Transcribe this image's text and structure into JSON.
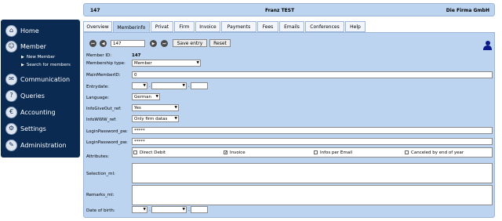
{
  "topbar": {
    "member_id": "147",
    "member_name": "Franz TEST",
    "company": "Die Firma GmbH"
  },
  "sidebar": {
    "items": [
      {
        "label": "Home",
        "icon": "home-icon"
      },
      {
        "label": "Member",
        "icon": "member-icon"
      },
      {
        "label": "Communication",
        "icon": "communication-icon"
      },
      {
        "label": "Queries",
        "icon": "queries-icon"
      },
      {
        "label": "Accounting",
        "icon": "accounting-icon"
      },
      {
        "label": "Settings",
        "icon": "settings-icon"
      },
      {
        "label": "Administration",
        "icon": "administration-icon"
      }
    ],
    "subitems": [
      {
        "label": "New Member"
      },
      {
        "label": "Search for members"
      }
    ]
  },
  "tabs": [
    {
      "label": "Overview"
    },
    {
      "label": "Memberinfo",
      "active": true
    },
    {
      "label": "Privat"
    },
    {
      "label": "Firm"
    },
    {
      "label": "Invoice"
    },
    {
      "label": "Payments"
    },
    {
      "label": "Fees"
    },
    {
      "label": "Emails"
    },
    {
      "label": "Conferences"
    },
    {
      "label": "Help"
    }
  ],
  "toolbar": {
    "record_value": "147",
    "save_label": "Save entry",
    "reset_label": "Reset"
  },
  "form": {
    "member_id": {
      "label": "Member ID:",
      "value": "147"
    },
    "membership_type": {
      "label": "Membership type:",
      "value": "Member"
    },
    "main_member_id": {
      "label": "MainMemberID:",
      "value": "0"
    },
    "entry_date": {
      "label": "Entrydate:",
      "separator": "."
    },
    "language": {
      "label": "Language:",
      "value": "German"
    },
    "info_give_out": {
      "label": "InfoGiveOut_ref:",
      "value": "Yes"
    },
    "info_www": {
      "label": "InfoWWW_ref:",
      "value": "Only firm datas"
    },
    "login_password": {
      "label": "LoginPassword_pw:",
      "value": "*****"
    },
    "login_password2": {
      "label": "LoginPassword_pw:",
      "value": "*****"
    },
    "attributes": {
      "label": "Attributes:",
      "options": [
        {
          "label": "Direct Debit",
          "checked": false
        },
        {
          "label": "Invoice",
          "checked": true
        },
        {
          "label": "Infos per Email",
          "checked": false
        },
        {
          "label": "Canceled by end of year",
          "checked": false
        }
      ]
    },
    "selection": {
      "label": "Selection_ml:"
    },
    "remarks": {
      "label": "Remarks_ml:"
    },
    "birth_date": {
      "label": "Date of birth:",
      "separator": "."
    }
  },
  "colors": {
    "sidebar_bg": "#0b2a52",
    "panel_bg": "#bcd4ef",
    "border": "#9bb6d8"
  }
}
